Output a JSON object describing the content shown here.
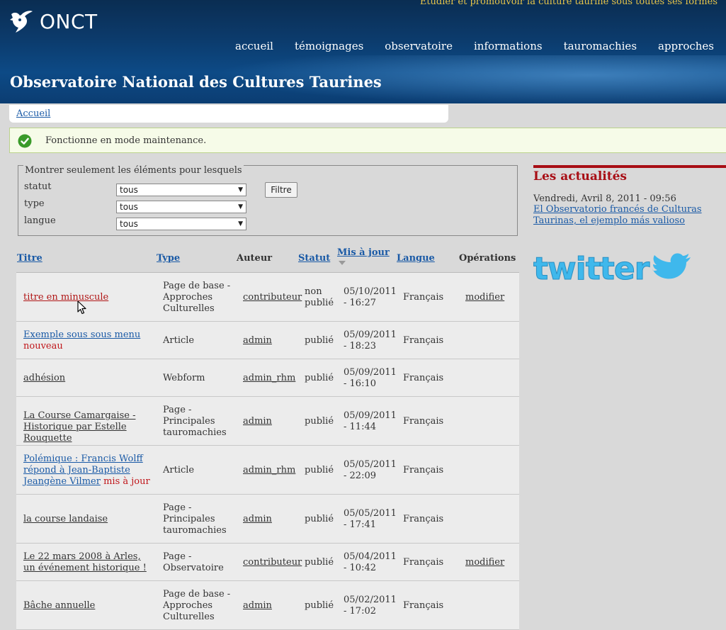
{
  "header": {
    "slogan": "Etudier et promouvoir la culture taurine sous toutes ses formes",
    "logo_text": "ONCT",
    "site_title": "Observatoire National des Cultures Taurines",
    "nav": [
      "accueil",
      "témoignages",
      "observatoire",
      "informations",
      "tauromachies",
      "approches"
    ]
  },
  "breadcrumb": {
    "home": "Accueil"
  },
  "message": {
    "text": "Fonctionne en mode maintenance."
  },
  "filter": {
    "legend": "Montrer seulement les éléments pour lesquels",
    "fields": [
      {
        "label": "statut",
        "value": "tous"
      },
      {
        "label": "type",
        "value": "tous"
      },
      {
        "label": "langue",
        "value": "tous"
      }
    ],
    "button": "Filtre"
  },
  "table": {
    "headers": {
      "title": "Titre",
      "type": "Type",
      "author": "Auteur",
      "status": "Statut",
      "updated": "Mis à jour",
      "language": "Langue",
      "operations": "Opérations"
    },
    "rows": [
      {
        "title": "titre en minuscule",
        "title_marker": "",
        "type": "Page de base - Approches Culturelles",
        "author": "contributeur",
        "status": "non publié",
        "date": "05/10/2011 - 16:27",
        "language": "Français",
        "op": "modifier"
      },
      {
        "title": "Exemple sous sous menu",
        "title_marker": "nouveau",
        "type": "Article",
        "author": "admin",
        "status": "publié",
        "date": "05/09/2011 - 18:23",
        "language": "Français",
        "op": ""
      },
      {
        "title": "adhésion",
        "title_marker": "",
        "type": "Webform",
        "author": "admin_rhm",
        "status": "publié",
        "date": "05/09/2011 - 16:10",
        "language": "Français",
        "op": ""
      },
      {
        "title": "La Course Camargaise - Historique par Estelle Rouquette",
        "title_marker": "",
        "type": "Page - Principales tauromachies",
        "author": "admin",
        "status": "publié",
        "date": "05/09/2011 - 11:44",
        "language": "Français",
        "op": ""
      },
      {
        "title": "Polémique : Francis Wolff répond à Jean-Baptiste Jeangène Vilmer",
        "title_marker": "mis à jour",
        "type": "Article",
        "author": "admin_rhm",
        "status": "publié",
        "date": "05/05/2011 - 22:09",
        "language": "Français",
        "op": ""
      },
      {
        "title": "la course landaise",
        "title_marker": "",
        "type": "Page - Principales tauromachies",
        "author": "admin",
        "status": "publié",
        "date": "05/05/2011 - 17:41",
        "language": "Français",
        "op": ""
      },
      {
        "title": "Le 22 mars 2008 à Arles, un événement historique !",
        "title_marker": "",
        "type": "Page - Observatoire",
        "author": "contributeur",
        "status": "publié",
        "date": "05/04/2011 - 10:42",
        "language": "Français",
        "op": "modifier"
      },
      {
        "title": "Bâche annuelle",
        "title_marker": "",
        "type": "Page de base - Approches Culturelles",
        "author": "admin",
        "status": "publié",
        "date": "05/02/2011 - 17:02",
        "language": "Français",
        "op": ""
      }
    ]
  },
  "sidebar": {
    "news_title": "Les actualités",
    "news_date": "Vendredi, Avril 8, 2011 - 09:56",
    "news_link": "El Observatorio francés de Culturas Taurinas, el ejemplo más valioso",
    "twitter_label": "twitter"
  },
  "colors": {
    "header_blue": "#0c3b6c",
    "slogan_gold": "#e8c64a",
    "news_red": "#a80e15",
    "link_blue": "#1a5aa6",
    "twitter_blue": "#3fb8ec"
  }
}
